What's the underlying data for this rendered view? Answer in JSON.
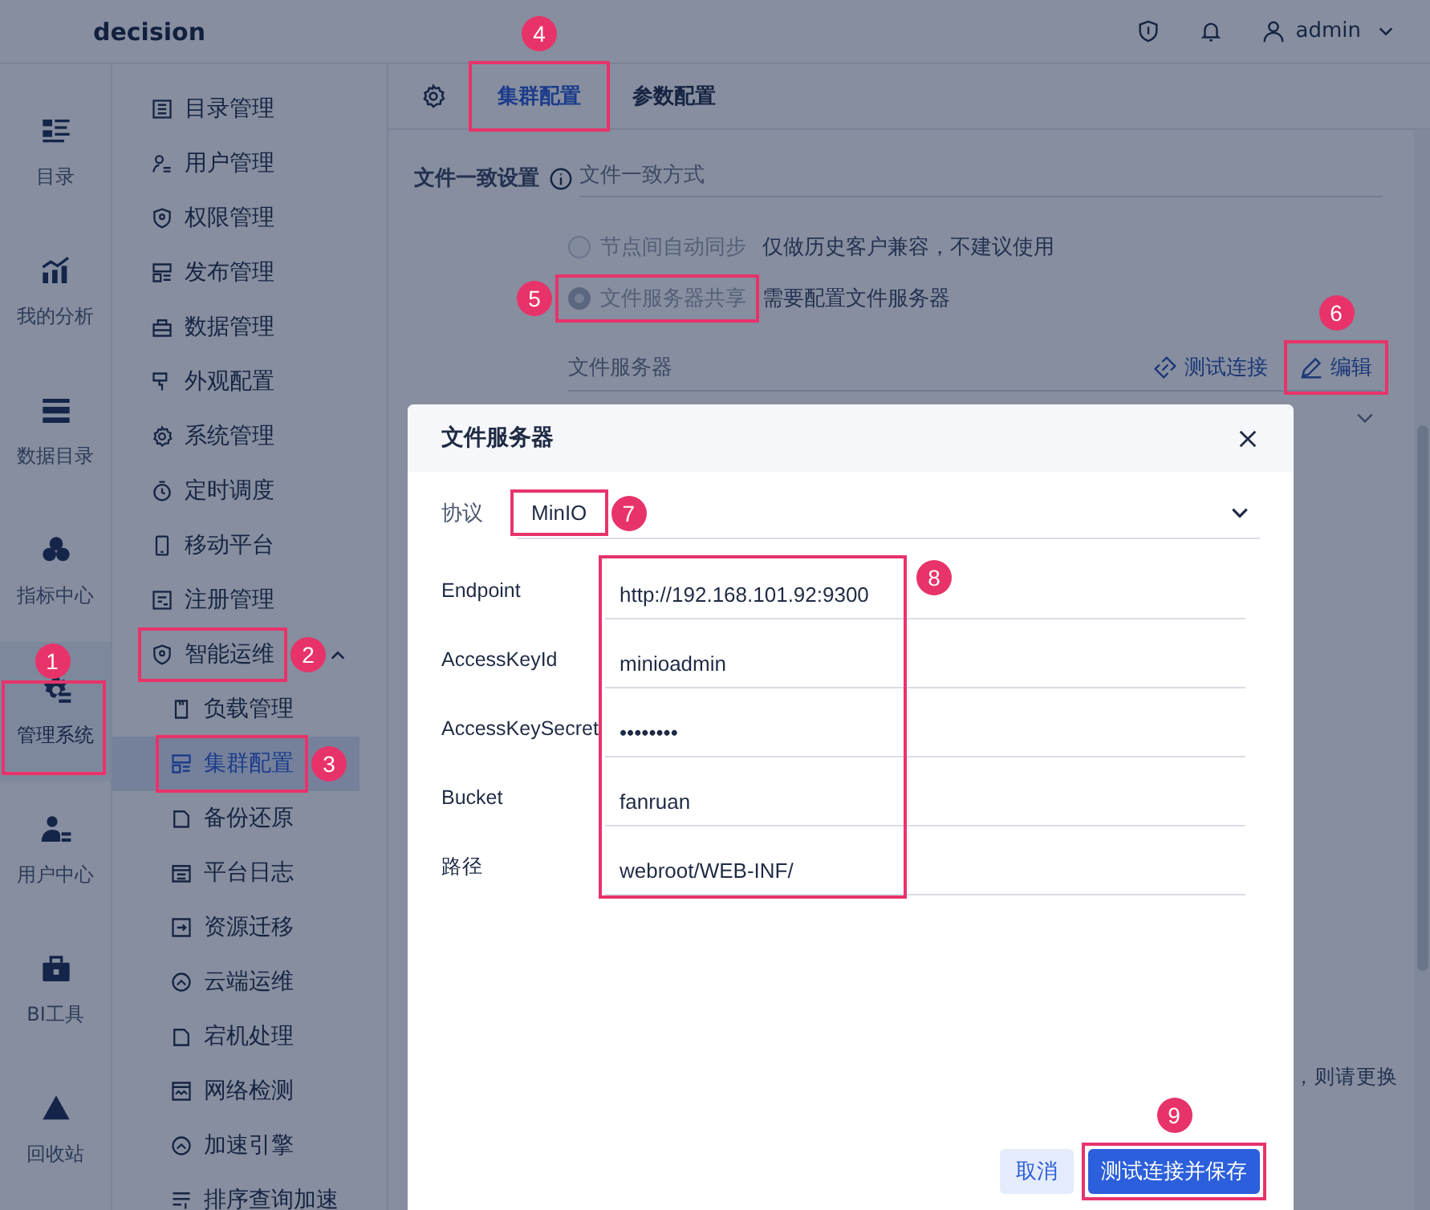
{
  "app": {
    "title": "decision"
  },
  "header": {
    "user": "admin"
  },
  "rail": [
    {
      "label": "目录",
      "selected": false
    },
    {
      "label": "我的分析",
      "selected": false
    },
    {
      "label": "数据目录",
      "selected": false
    },
    {
      "label": "指标中心",
      "selected": false
    },
    {
      "label": "管理系统",
      "selected": true,
      "callout": "1"
    },
    {
      "label": "用户中心",
      "selected": false
    },
    {
      "label": "BI工具",
      "selected": false
    },
    {
      "label": "回收站",
      "selected": false
    }
  ],
  "menu": [
    {
      "label": "目录管理"
    },
    {
      "label": "用户管理"
    },
    {
      "label": "权限管理"
    },
    {
      "label": "发布管理"
    },
    {
      "label": "数据管理"
    },
    {
      "label": "外观配置"
    },
    {
      "label": "系统管理"
    },
    {
      "label": "定时调度"
    },
    {
      "label": "移动平台"
    },
    {
      "label": "注册管理"
    },
    {
      "label": "智能运维",
      "expanded": true,
      "callout": "2",
      "children": [
        {
          "label": "负载管理",
          "selected": false
        },
        {
          "label": "集群配置",
          "selected": true,
          "callout": "3"
        },
        {
          "label": "备份还原",
          "selected": false
        },
        {
          "label": "平台日志",
          "selected": false
        },
        {
          "label": "资源迁移",
          "selected": false
        },
        {
          "label": "云端运维",
          "selected": false
        },
        {
          "label": "宕机处理",
          "selected": false
        },
        {
          "label": "网络检测",
          "selected": false
        },
        {
          "label": "加速引擎",
          "selected": false
        },
        {
          "label": "排序查询加速",
          "selected": false
        }
      ]
    }
  ],
  "tabs": [
    {
      "label": "集群配置",
      "selected": true,
      "callout": "4"
    },
    {
      "label": "参数配置",
      "selected": false
    }
  ],
  "settings": {
    "label": "文件一致设置",
    "field_label": "文件一致方式",
    "options": [
      {
        "label": "节点间自动同步",
        "note": "仅做历史客户兼容，不建议使用",
        "selected": false,
        "disabled": true
      },
      {
        "label": "文件服务器共享",
        "note": "需要配置文件服务器",
        "selected": true,
        "disabled": true,
        "callout": "5"
      }
    ],
    "server_label": "文件服务器",
    "test_link": "测试连接",
    "edit_link": {
      "label": "编辑",
      "callout": "6"
    },
    "partial_note": "，则请更换"
  },
  "dialog": {
    "title": "文件服务器",
    "protocol": {
      "label": "协议",
      "value": "MinIO",
      "callout": "7"
    },
    "fields": [
      {
        "label": "Endpoint",
        "value": "http://192.168.101.92:9300"
      },
      {
        "label": "AccessKeyId",
        "value": "minioadmin"
      },
      {
        "label": "AccessKeySecret",
        "value": "••••••••"
      },
      {
        "label": "Bucket",
        "value": "fanruan"
      },
      {
        "label": "路径",
        "value": "webroot/WEB-INF/"
      }
    ],
    "fields_callout": "8",
    "buttons": [
      {
        "label": "取消",
        "kind": "secondary"
      },
      {
        "label": "测试连接并保存",
        "kind": "primary",
        "callout": "9"
      }
    ]
  }
}
